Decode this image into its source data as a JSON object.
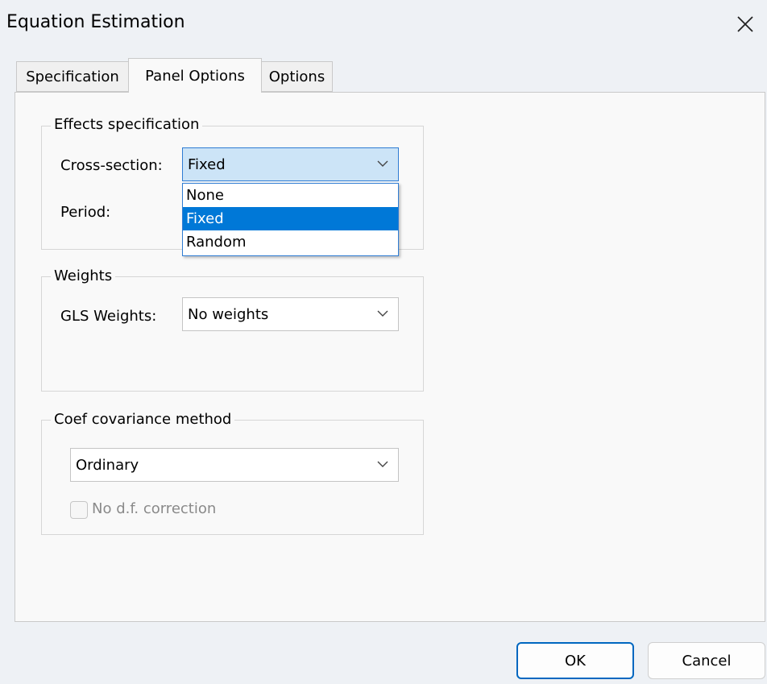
{
  "window": {
    "title": "Equation Estimation"
  },
  "tabs": [
    {
      "label": "Specification"
    },
    {
      "label": "Panel Options"
    },
    {
      "label": "Options"
    }
  ],
  "effects": {
    "group_label": "Effects specification",
    "cross_section_label": "Cross-section:",
    "cross_section_value": "Fixed",
    "period_label": "Period:",
    "dropdown_options": [
      "None",
      "Fixed",
      "Random"
    ],
    "selected_option": "Fixed"
  },
  "weights": {
    "group_label": "Weights",
    "gls_label": "GLS Weights:",
    "gls_value": "No weights"
  },
  "covariance": {
    "group_label": "Coef covariance method",
    "method_value": "Ordinary",
    "df_correction_label": "No d.f. correction",
    "df_correction_checked": false
  },
  "buttons": {
    "ok": "OK",
    "cancel": "Cancel"
  },
  "colors": {
    "accent": "#0078d7",
    "open_combo": "#cce4f7",
    "window_bg": "#eef1f5",
    "panel_bg": "#f9f9f9"
  }
}
